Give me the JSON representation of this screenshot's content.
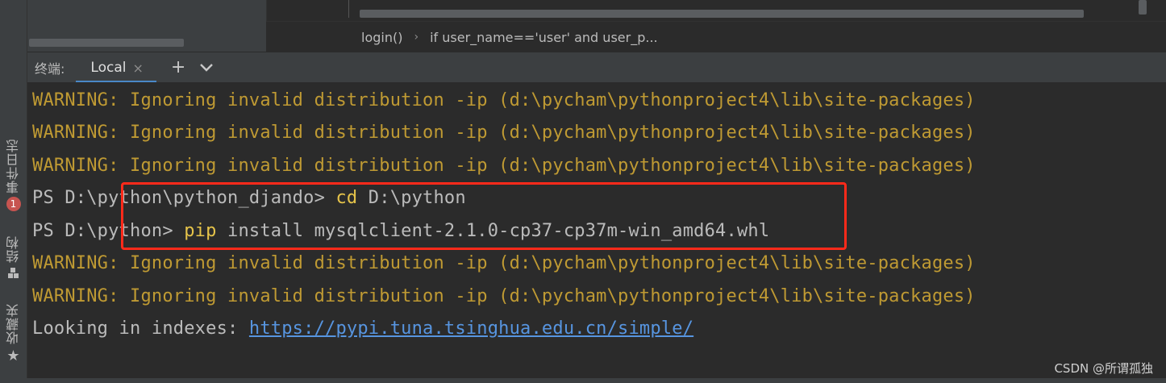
{
  "left_strip": {
    "event_log_label": "事件日志",
    "event_log_badge": "1",
    "structure_label": "结构",
    "favorites_label": "收藏夹"
  },
  "breadcrumb": {
    "item1": "login()",
    "separator": "›",
    "item2": "if user_name=='user' and user_p..."
  },
  "terminal": {
    "title": "终端:",
    "tab_label": "Local",
    "tab_close": "×",
    "add_button": "+",
    "menu_button": "⌄"
  },
  "lines": {
    "w1": "WARNING: Ignoring invalid distribution -ip (d:\\pycham\\pythonproject4\\lib\\site-packages)",
    "w2": "WARNING: Ignoring invalid distribution -ip (d:\\pycham\\pythonproject4\\lib\\site-packages)",
    "w3": "WARNING: Ignoring invalid distribution -ip (d:\\pycham\\pythonproject4\\lib\\site-packages)",
    "ps1_prompt": "PS D:\\python\\python_djando> ",
    "ps1_cmd": "cd",
    "ps1_args": " D:\\python",
    "ps2_prompt": "PS D:\\python> ",
    "ps2_cmd": "pip",
    "ps2_args": " install mysqlclient-2.1.0-cp37-cp37m-win_amd64.whl",
    "w4": "WARNING: Ignoring invalid distribution -ip (d:\\pycham\\pythonproject4\\lib\\site-packages)",
    "w5": "WARNING: Ignoring invalid distribution -ip (d:\\pycham\\pythonproject4\\lib\\site-packages)",
    "looking_prefix": "Looking in indexes: ",
    "looking_url": "https://pypi.tuna.tsinghua.edu.cn/simple/"
  },
  "watermark": "CSDN @所谓孤独",
  "colors": {
    "warning": "#bf9a33",
    "command": "#e6c44a",
    "link": "#5795e0",
    "highlight_border": "#ff2a1a",
    "tab_underline": "#4a88c7"
  }
}
